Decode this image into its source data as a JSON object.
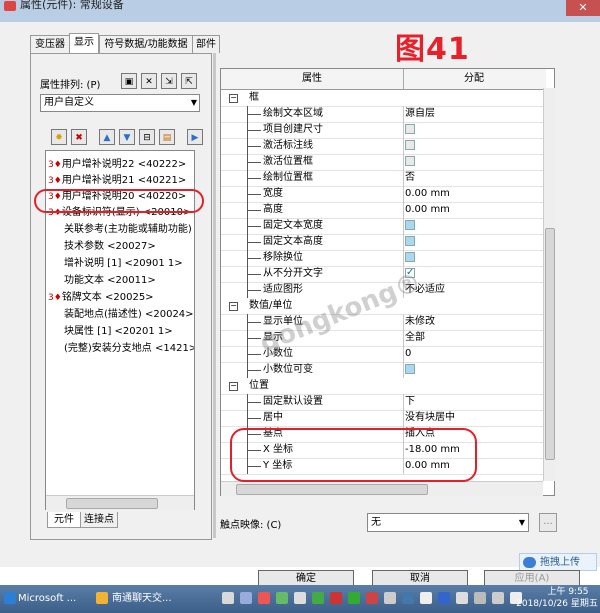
{
  "window": {
    "title": "属性(元件): 常规设备",
    "close_glyph": "✕"
  },
  "figure_label": "图41",
  "tabs": [
    "变压器",
    "显示",
    "符号数据/功能数据",
    "部件"
  ],
  "left": {
    "sort_label": "属性排列: (P)",
    "sort_value": "用户自定义",
    "list": [
      {
        "mark": "3",
        "label": "用户增补说明22 <40222>"
      },
      {
        "mark": "3",
        "label": "用户增补说明21 <40221>"
      },
      {
        "mark": "3",
        "label": "用户增补说明20 <40220>"
      },
      {
        "mark": "3",
        "label": "设备标识符(显示) <20010>"
      },
      {
        "mark": "",
        "label": "关联参考(主功能或辅助功能) <"
      },
      {
        "mark": "",
        "label": "技术参数 <20027>"
      },
      {
        "mark": "",
        "label": "增补说明 [1] <20901 1>"
      },
      {
        "mark": "",
        "label": "功能文本 <20011>"
      },
      {
        "mark": "3",
        "label": "铭牌文本 <20025>"
      },
      {
        "mark": "",
        "label": "装配地点(描述性) <20024>"
      },
      {
        "mark": "",
        "label": "块属性 [1] <20201 1>"
      },
      {
        "mark": "",
        "label": "(完整)安装分支地点 <1421>"
      }
    ],
    "bottom_tabs": [
      "元件",
      "连接点"
    ]
  },
  "grid": {
    "header": {
      "property": "属性",
      "value": "分配"
    },
    "rows": [
      {
        "kind": "cat",
        "name": "框"
      },
      {
        "kind": "row",
        "name": "绘制文本区域",
        "value": "源自层"
      },
      {
        "kind": "row",
        "name": "项目创建尺寸",
        "check": "grey"
      },
      {
        "kind": "row",
        "name": "激活标注线",
        "check": "grey"
      },
      {
        "kind": "row",
        "name": "激活位置框",
        "check": "grey"
      },
      {
        "kind": "row",
        "name": "绘制位置框",
        "value": "否"
      },
      {
        "kind": "row",
        "name": "宽度",
        "value": "0.00 mm"
      },
      {
        "kind": "row",
        "name": "高度",
        "value": "0.00 mm"
      },
      {
        "kind": "row",
        "name": "固定文本宽度",
        "check": "blue"
      },
      {
        "kind": "row",
        "name": "固定文本高度",
        "check": "blue"
      },
      {
        "kind": "row",
        "name": "移除换位",
        "check": "blue"
      },
      {
        "kind": "row",
        "name": "从不分开文字",
        "check": "on"
      },
      {
        "kind": "row",
        "name": "适应图形",
        "value": "不必适应"
      },
      {
        "kind": "cat",
        "name": "数值/单位"
      },
      {
        "kind": "row",
        "name": "显示单位",
        "value": "未修改"
      },
      {
        "kind": "row",
        "name": "显示",
        "value": "全部"
      },
      {
        "kind": "row",
        "name": "小数位",
        "value": "0"
      },
      {
        "kind": "row",
        "name": "小数位可变",
        "check": "blue"
      },
      {
        "kind": "cat",
        "name": "位置"
      },
      {
        "kind": "row",
        "name": "固定默认设置",
        "value": "下"
      },
      {
        "kind": "row",
        "name": "居中",
        "value": "没有块居中"
      },
      {
        "kind": "row",
        "name": "基点",
        "value": "插入点"
      },
      {
        "kind": "row",
        "name": "X 坐标",
        "value": "-18.00 mm"
      },
      {
        "kind": "row",
        "name": "Y 坐标",
        "value": "0.00 mm"
      }
    ]
  },
  "trigger": {
    "label": "触点映像: (C)",
    "value": "无",
    "ellipsis": "..."
  },
  "buttons": {
    "ok": "确定",
    "cancel": "取消",
    "apply": "应用(A)"
  },
  "upload_label": "拖拽上传",
  "watermark": "gongkong®",
  "taskbar": {
    "item1": "Microsoft ...",
    "item2": "南通聊天交...",
    "time": "上午 9:55",
    "date": "2018/10/26 星期五"
  }
}
